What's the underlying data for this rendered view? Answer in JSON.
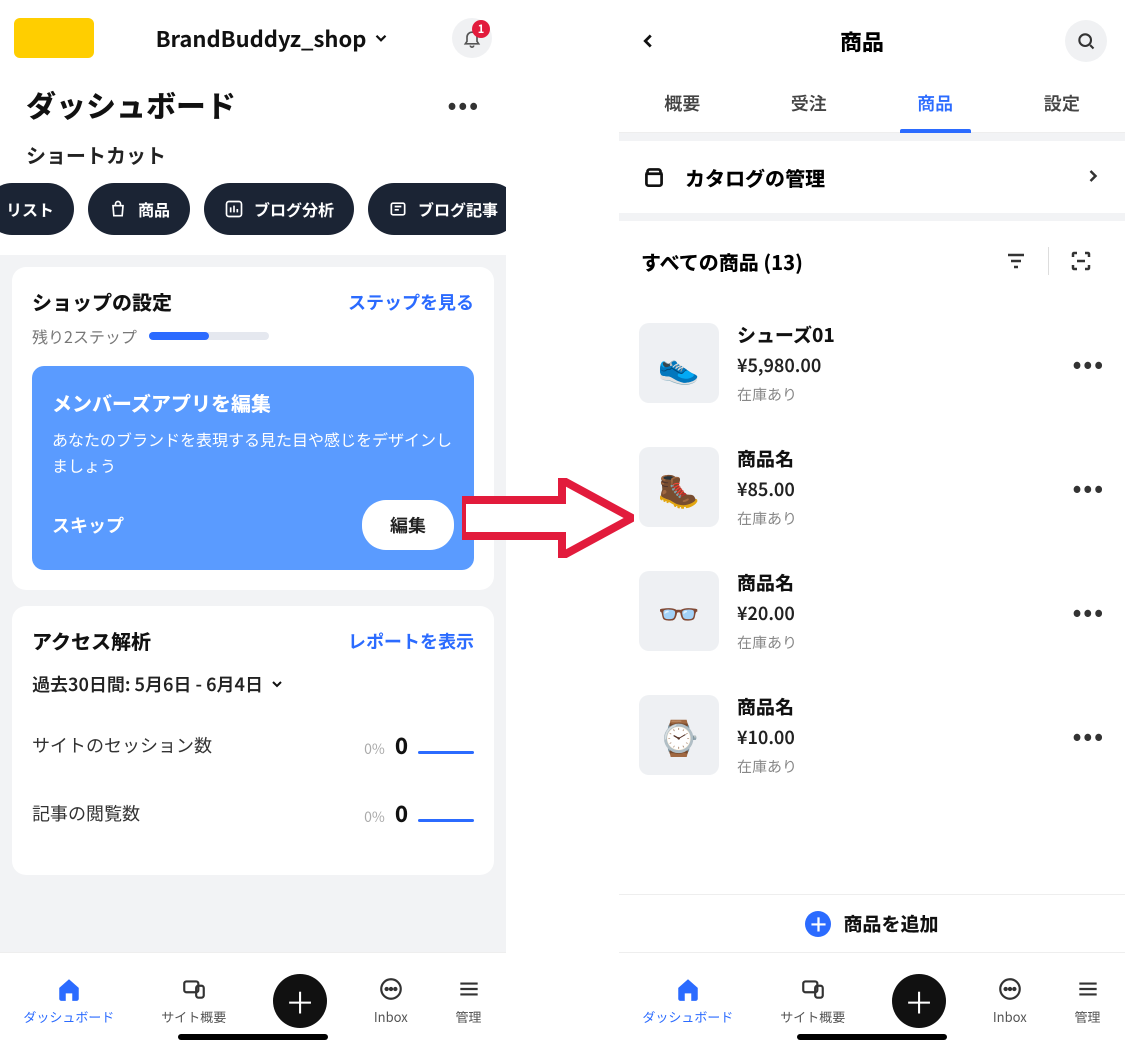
{
  "left": {
    "shop_name": "BrandBuddyz_shop",
    "notification_count": "1",
    "dashboard_title": "ダッシュボード",
    "shortcuts_label": "ショートカット",
    "chips": [
      {
        "label": "リスト",
        "name": "shortcut-list"
      },
      {
        "label": "商品",
        "name": "shortcut-products"
      },
      {
        "label": "ブログ分析",
        "name": "shortcut-blog-analytics"
      },
      {
        "label": "ブログ記事",
        "name": "shortcut-blog-posts"
      }
    ],
    "setup_card": {
      "title": "ショップの設定",
      "link": "ステップを見る",
      "steps_text": "残り2ステップ",
      "promo_title": "メンバーズアプリを編集",
      "promo_desc": "あなたのブランドを表現する見た目や感じをデザインしましょう",
      "skip": "スキップ",
      "edit": "編集"
    },
    "analytics_card": {
      "title": "アクセス解析",
      "link": "レポートを表示",
      "date": "過去30日間: 5月6日 - 6月4日",
      "rows": [
        {
          "label": "サイトのセッション数",
          "pct": "0%",
          "value": "0"
        },
        {
          "label": "記事の閲覧数",
          "pct": "0%",
          "value": "0"
        }
      ]
    },
    "nav": {
      "dashboard": "ダッシュボード",
      "overview": "サイト概要",
      "inbox": "Inbox",
      "manage": "管理"
    }
  },
  "right": {
    "title": "商品",
    "tabs": {
      "overview": "概要",
      "orders": "受注",
      "products": "商品",
      "settings": "設定"
    },
    "catalog": "カタログの管理",
    "all_products_prefix": "すべての商品",
    "all_products_count": "(13)",
    "items": [
      {
        "name": "シューズ01",
        "price": "¥5,980.00",
        "stock": "在庫あり",
        "emoji": "👟"
      },
      {
        "name": "商品名",
        "price": "¥85.00",
        "stock": "在庫あり",
        "emoji": "🥾"
      },
      {
        "name": "商品名",
        "price": "¥20.00",
        "stock": "在庫あり",
        "emoji": "👓"
      },
      {
        "name": "商品名",
        "price": "¥10.00",
        "stock": "在庫あり",
        "emoji": "⌚"
      }
    ],
    "add_product": "商品を追加",
    "nav": {
      "dashboard": "ダッシュボード",
      "overview": "サイト概要",
      "inbox": "Inbox",
      "manage": "管理"
    }
  }
}
